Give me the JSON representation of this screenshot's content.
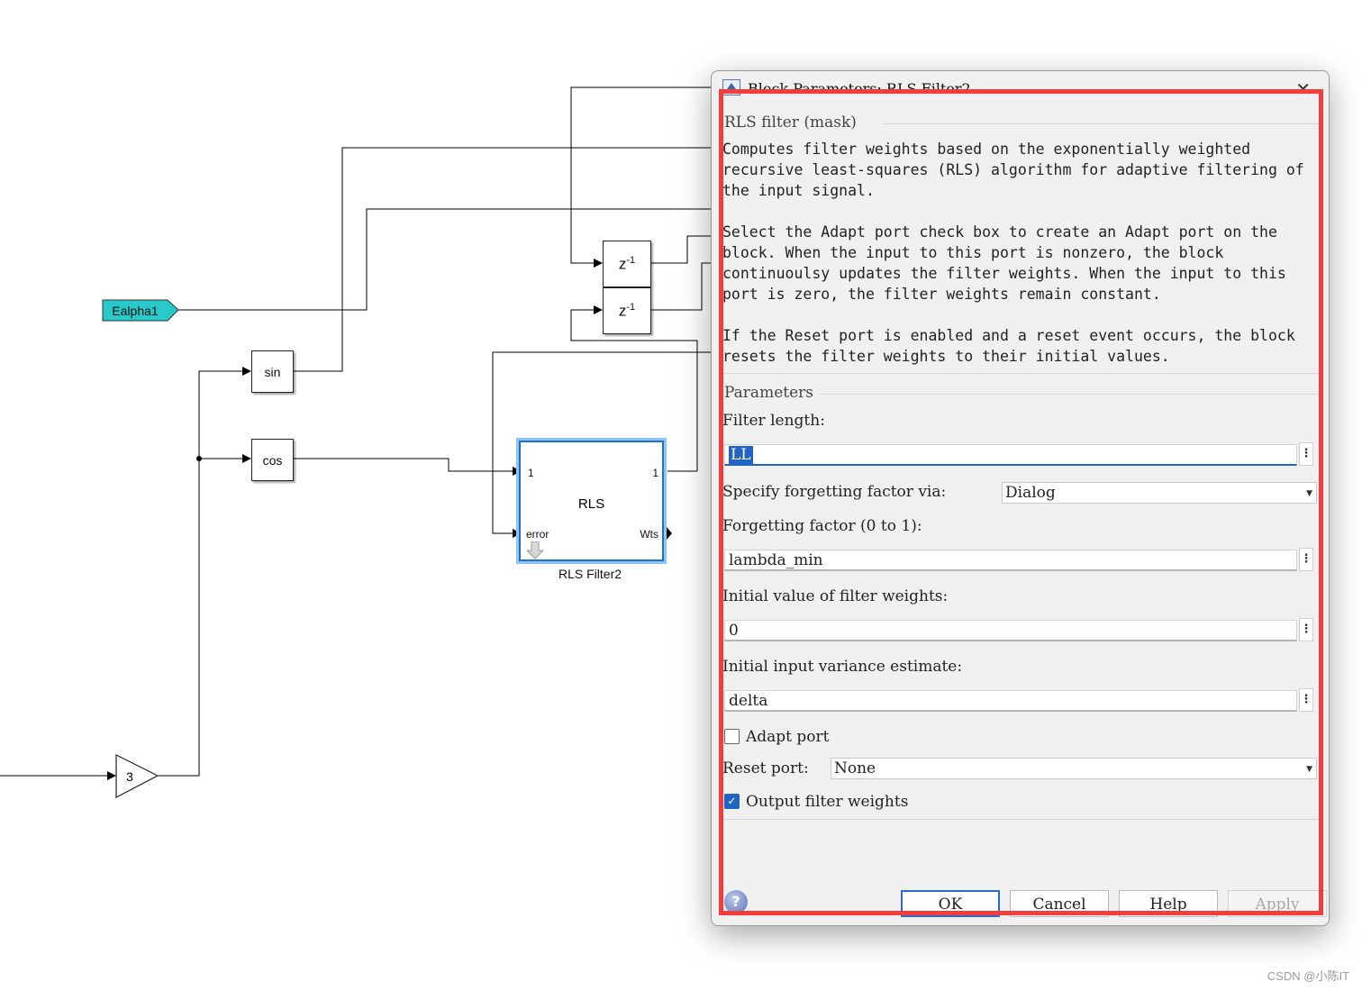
{
  "diagram": {
    "goto_tag": "Ealpha1",
    "sin_label": "sin",
    "cos_label": "cos",
    "delay_label": "z",
    "delay_exp": "-1",
    "gain_value": "3",
    "rls_block": {
      "name": "RLS",
      "port_in_1": "1",
      "port_in_error": "error",
      "port_out_1": "1",
      "port_out_wts": "Wts",
      "caption": "RLS Filter2"
    }
  },
  "dialog": {
    "title": "Block Parameters: RLS Filter2",
    "mask_header": "RLS filter (mask)",
    "description": "Computes filter weights based on the exponentially weighted\nrecursive least-squares (RLS) algorithm for adaptive filtering of\nthe input signal.\n\nSelect the Adapt port check box to create an Adapt port on the\nblock. When the input to this port is nonzero, the block\ncontinuoulsy updates the filter weights. When the input to this\nport is zero, the filter weights remain constant.\n\nIf the Reset port is enabled and a reset event occurs, the block\nresets the filter weights to their initial values.",
    "parameters_header": "Parameters",
    "filter_length_label": "Filter length:",
    "filter_length_value": "LL",
    "forgetting_via_label": "Specify forgetting factor via:",
    "forgetting_via_value": "Dialog",
    "forgetting_factor_label": "Forgetting factor (0 to 1):",
    "forgetting_factor_value": "lambda_min",
    "initial_weights_label": "Initial value of filter weights:",
    "initial_weights_value": "0",
    "initial_variance_label": "Initial input variance estimate:",
    "initial_variance_value": "delta",
    "adapt_port_label": "Adapt port",
    "adapt_port_checked": false,
    "reset_port_label": "Reset port:",
    "reset_port_value": "None",
    "output_weights_label": "Output filter weights",
    "output_weights_checked": true,
    "buttons": {
      "ok": "OK",
      "cancel": "Cancel",
      "help": "Help",
      "apply": "Apply"
    }
  },
  "watermark": "CSDN @小陈IT",
  "colors": {
    "goto_fill": "#2ac9c9",
    "highlight_border": "#f23d3d",
    "selection_blue": "#2363c6"
  }
}
